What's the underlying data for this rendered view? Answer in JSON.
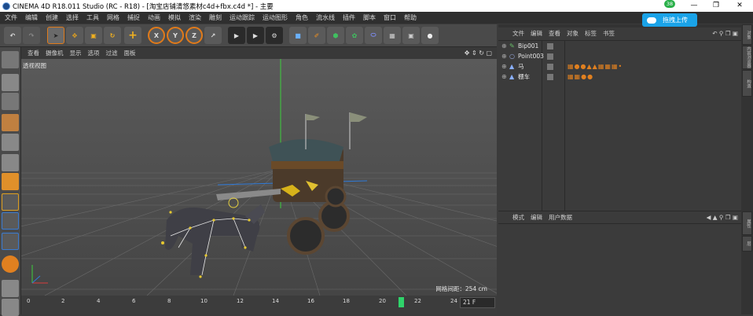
{
  "window": {
    "title": "CINEMA 4D R18.011 Studio (RC - R18) - [淘宝店铺清悠素材c4d+fbx.c4d *] - 主要"
  },
  "menu": [
    "文件",
    "编辑",
    "创建",
    "选择",
    "工具",
    "网格",
    "捕捉",
    "动画",
    "模拟",
    "渲染",
    "雕刻",
    "运动跟踪",
    "运动图形",
    "角色",
    "流水线",
    "插件",
    "脚本",
    "窗口",
    "帮助"
  ],
  "overlay": {
    "badge": "38",
    "upload_label": "拖拽上传"
  },
  "toolbar": {
    "axis_x": "X",
    "axis_y": "Y",
    "axis_z": "Z"
  },
  "viewport": {
    "menu": [
      "查看",
      "摄像机",
      "显示",
      "选项",
      "过滤",
      "面板"
    ],
    "label": "透视视图",
    "grid_label": "网格间距：254 cm"
  },
  "timeline": {
    "ticks": [
      "0",
      "2",
      "4",
      "6",
      "8",
      "10",
      "12",
      "14",
      "16",
      "18",
      "20",
      "22",
      "24"
    ],
    "current_frame": "21 F"
  },
  "object_manager": {
    "menu": [
      "文件",
      "编辑",
      "查看",
      "对象",
      "标签",
      "书签"
    ],
    "objects": [
      {
        "name": "Bip001"
      },
      {
        "name": "Point003"
      },
      {
        "name": "马"
      },
      {
        "name": "棚车"
      }
    ]
  },
  "attribute_manager": {
    "menu": [
      "模式",
      "编辑",
      "用户数据"
    ]
  },
  "right_tabs": [
    "对象",
    "内容浏览器",
    "构造",
    "属性",
    "层"
  ],
  "colors": {
    "accent": "#1aa3e8",
    "badge": "#2ab04a",
    "timeline_marker": "#2fd36a"
  }
}
